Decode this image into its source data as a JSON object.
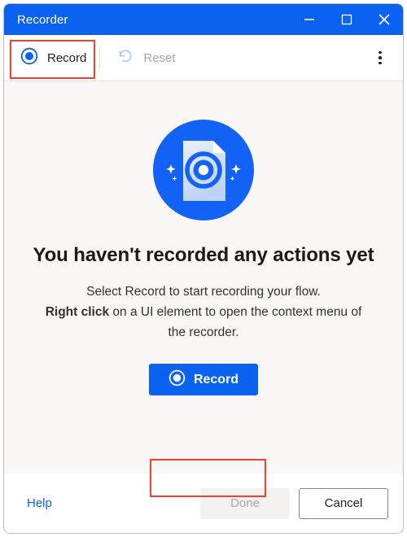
{
  "window": {
    "title": "Recorder",
    "accent_color": "#0b61f0",
    "controls": [
      {
        "name": "minimize",
        "glyph": "minimize-icon"
      },
      {
        "name": "maximize",
        "glyph": "maximize-icon"
      },
      {
        "name": "close",
        "glyph": "close-icon"
      }
    ]
  },
  "toolbar": {
    "record_label": "Record",
    "record_icon": "record-circle-icon",
    "reset_label": "Reset",
    "reset_icon": "undo-arrow-icon",
    "reset_disabled": true,
    "more_icon": "more-vertical-icon"
  },
  "main": {
    "illustration_icon": "document-record-illustration",
    "headline": "You haven't recorded any actions yet",
    "body_line1": "Select Record to start recording your flow.",
    "body_bold": "Right click",
    "body_line2_rest": " on a UI element to open the context menu of the recorder.",
    "record_button_label": "Record",
    "record_button_icon": "record-circle-icon"
  },
  "footer": {
    "help_label": "Help",
    "done_label": "Done",
    "done_disabled": true,
    "cancel_label": "Cancel"
  },
  "annotations": {
    "highlight_color": "#f6402c",
    "boxes": [
      {
        "target": "toolbar-record"
      },
      {
        "target": "main-record-button"
      }
    ]
  }
}
